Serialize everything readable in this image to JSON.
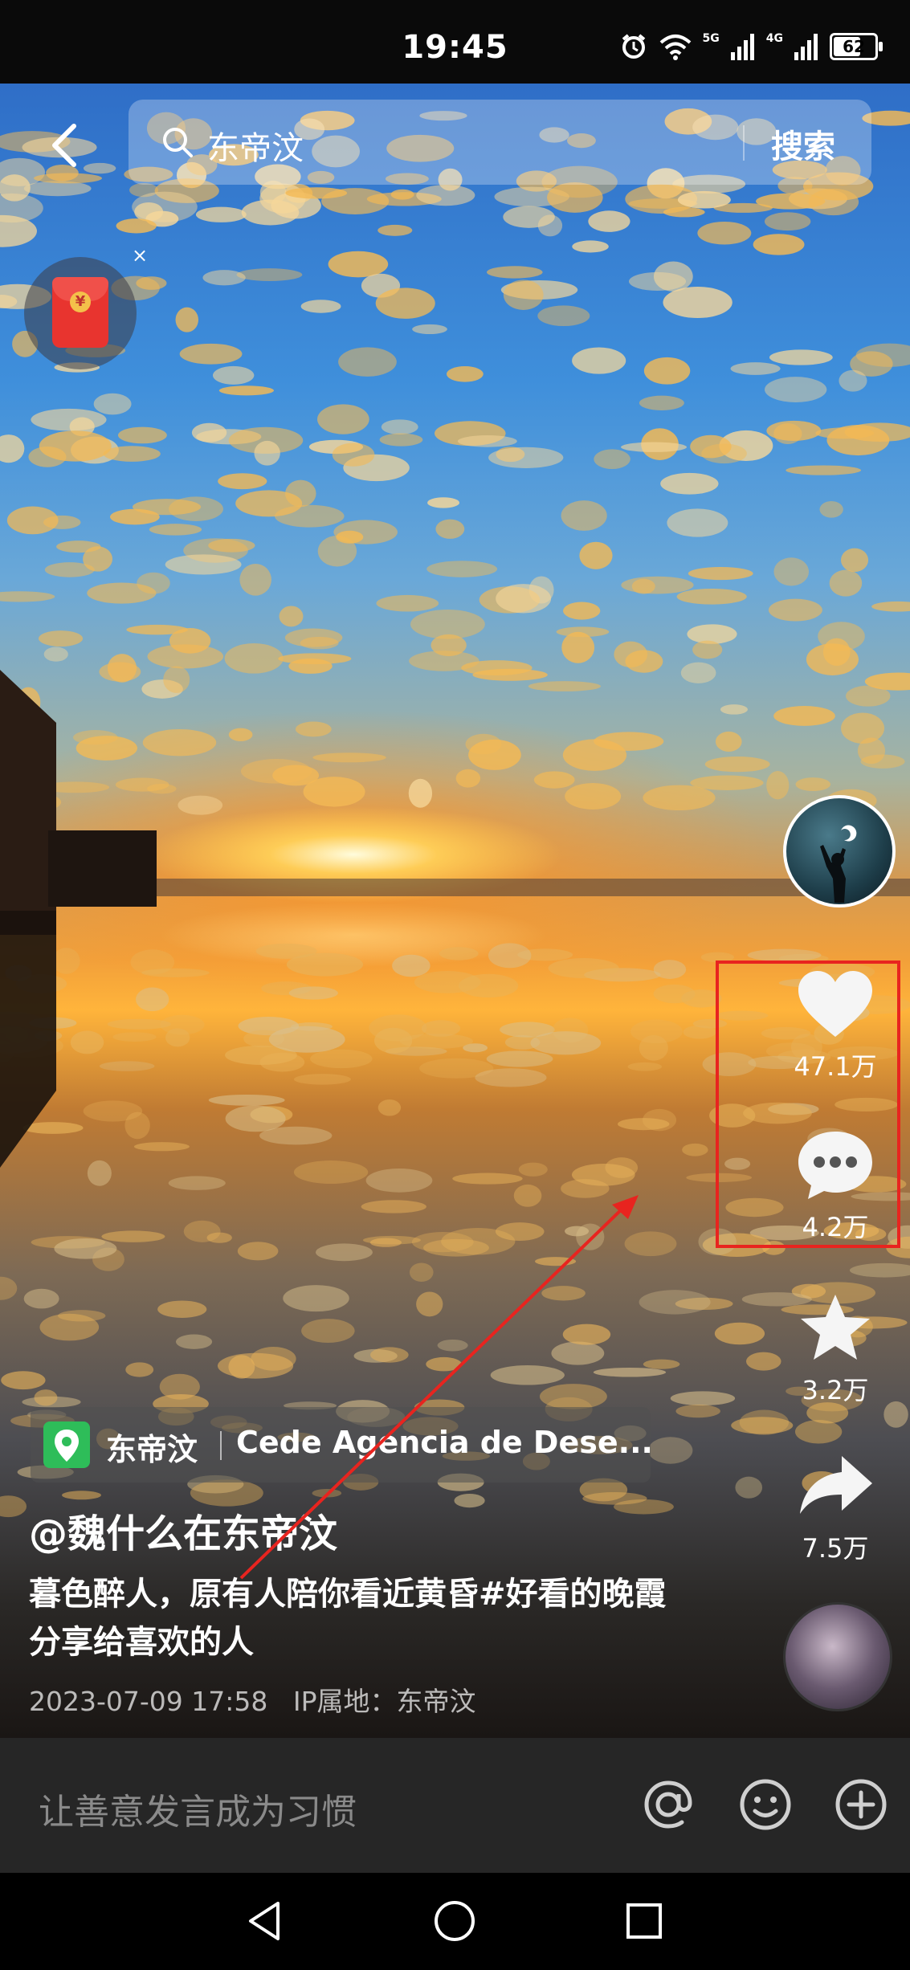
{
  "status_bar": {
    "time": "19:45",
    "battery": "62",
    "signal_labels": [
      "5G",
      "4G"
    ]
  },
  "search": {
    "query": "东帝汶",
    "button_label": "搜索"
  },
  "red_packet": {
    "symbol": "¥",
    "close": "×"
  },
  "actions": {
    "likes": "47.1万",
    "comments": "4.2万",
    "favorites": "3.2万",
    "shares": "7.5万"
  },
  "post": {
    "location_name": "东帝汶",
    "location_place": "Cede Agencia de Dese...",
    "username": "@魏什么在东帝汶",
    "caption": "暮色醉人，原有人陪你看近黄昏#好看的晚霞分享给喜欢的人",
    "timestamp": "2023-07-09 17:58",
    "ip_location": "IP属地：东帝汶"
  },
  "comment_bar": {
    "placeholder": "让善意发言成为习惯"
  },
  "colors": {
    "highlight": "#e8241f",
    "location_pin": "#2ebd59",
    "red_packet": "#e8342f"
  }
}
